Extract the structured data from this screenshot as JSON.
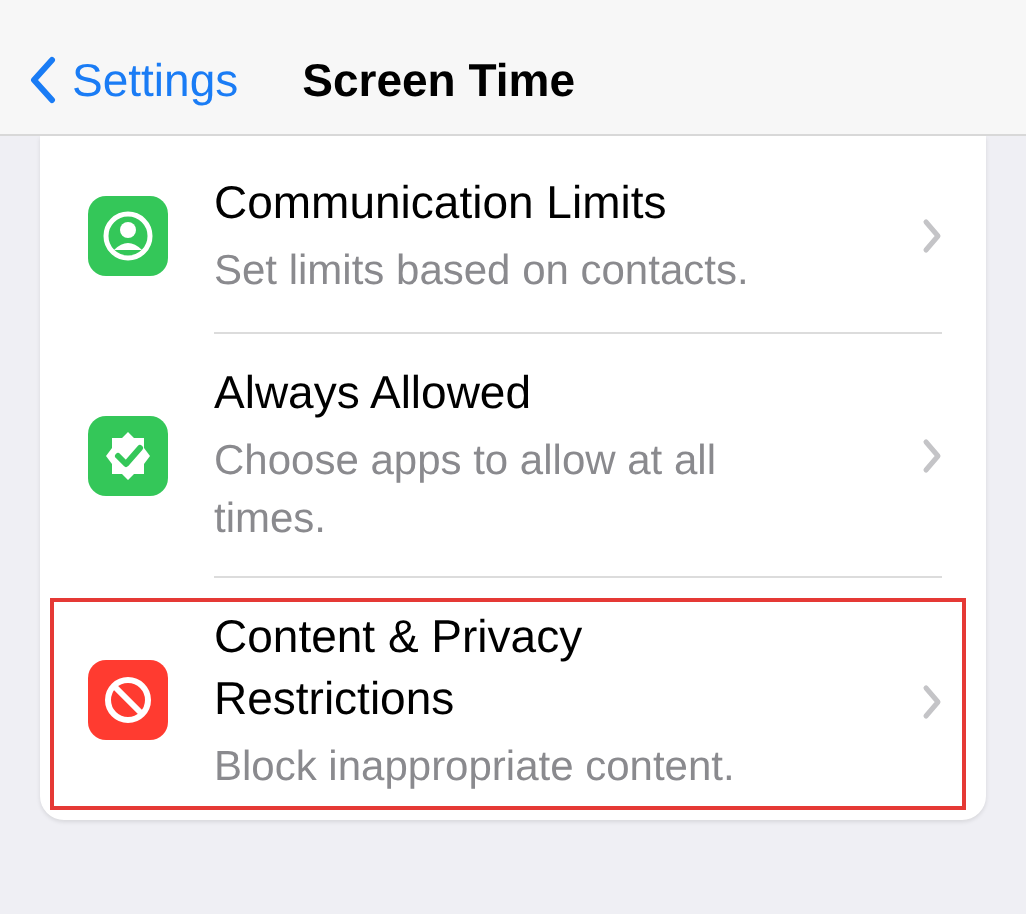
{
  "nav_bar": {
    "back_label": "Settings",
    "title": "Screen Time"
  },
  "items": [
    {
      "title": "Communication Limits",
      "subtitle": "Set limits based on contacts.",
      "color": "#34c759",
      "highlighted": false
    },
    {
      "title": "Always Allowed",
      "subtitle": "Choose apps to allow at all times.",
      "color": "#34c759",
      "highlighted": false
    },
    {
      "title": "Content & Privacy Restrictions",
      "subtitle": "Block inappropriate content.",
      "color": "#ff3b30",
      "highlighted": true
    }
  ]
}
